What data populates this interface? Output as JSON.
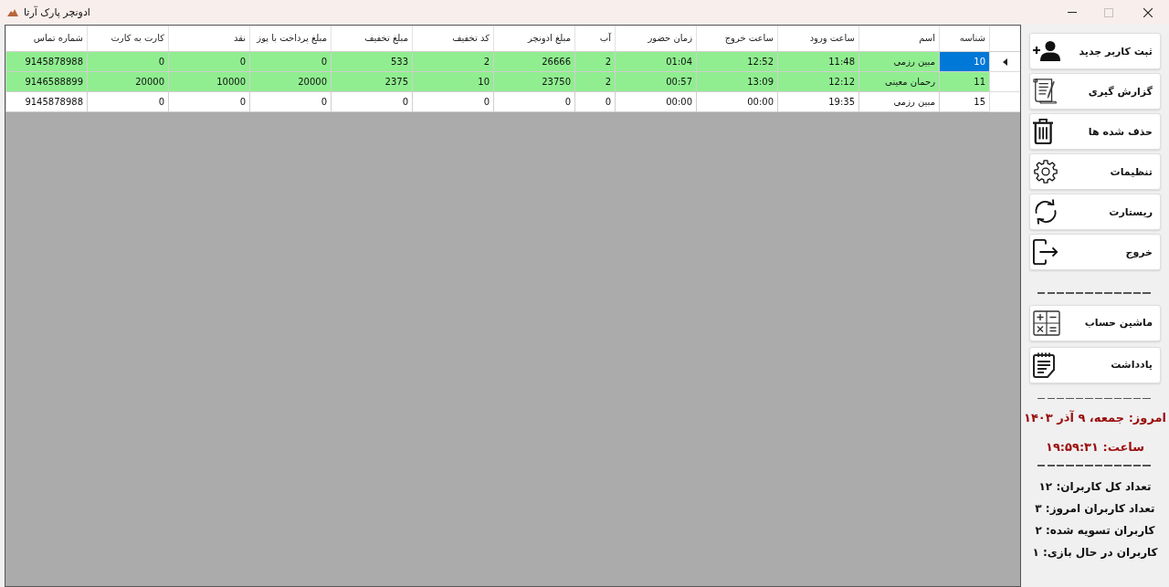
{
  "window": {
    "title": "ادونچر پارک آرتا",
    "maximize_disabled": true
  },
  "table": {
    "columns": [
      "شناسه",
      "اسم",
      "ساعت ورود",
      "ساعت خروج",
      "زمان حضور",
      "آب",
      "مبلغ ادونچر",
      "کد تخفیف",
      "مبلغ تخفیف",
      "مبلغ پرداخت با پوز",
      "نقد",
      "کارت به کارت",
      "شماره تماس"
    ],
    "rows": [
      {
        "selected": true,
        "settled": true,
        "cells": [
          "10",
          "مبین رزمی",
          "11:48",
          "12:52",
          "01:04",
          "2",
          "26666",
          "2",
          "533",
          "0",
          "0",
          "0",
          "9145878988"
        ]
      },
      {
        "selected": false,
        "settled": true,
        "cells": [
          "11",
          "رحمان معینی",
          "12:12",
          "13:09",
          "00:57",
          "2",
          "23750",
          "10",
          "2375",
          "20000",
          "10000",
          "20000",
          "9146588899"
        ]
      },
      {
        "selected": false,
        "settled": false,
        "cells": [
          "15",
          "مبین رزمی",
          "19:35",
          "00:00",
          "00:00",
          "0",
          "0",
          "0",
          "0",
          "0",
          "0",
          "0",
          "9145878988"
        ]
      }
    ]
  },
  "sidebar": {
    "buttons": [
      {
        "label": "ثبت کاربر جدید"
      },
      {
        "label": "گزارش گیری"
      },
      {
        "label": "حذف شده ها"
      },
      {
        "label": "تنظیمات"
      },
      {
        "label": "ریستارت"
      },
      {
        "label": "خروج"
      }
    ],
    "tools": [
      {
        "label": "ماشین حساب"
      },
      {
        "label": "یادداشت"
      }
    ],
    "date": "امروز: جمعه، ۹ آذر ۱۴۰۳",
    "time": "ساعت: ۱۹:۵۹:۳۱",
    "stats": [
      "تعداد کل کاربران: ۱۲",
      "تعداد کاربران امروز: ۳",
      "کاربران تسویه شده: ۲",
      "کاربران در حال بازی: ۱"
    ]
  }
}
